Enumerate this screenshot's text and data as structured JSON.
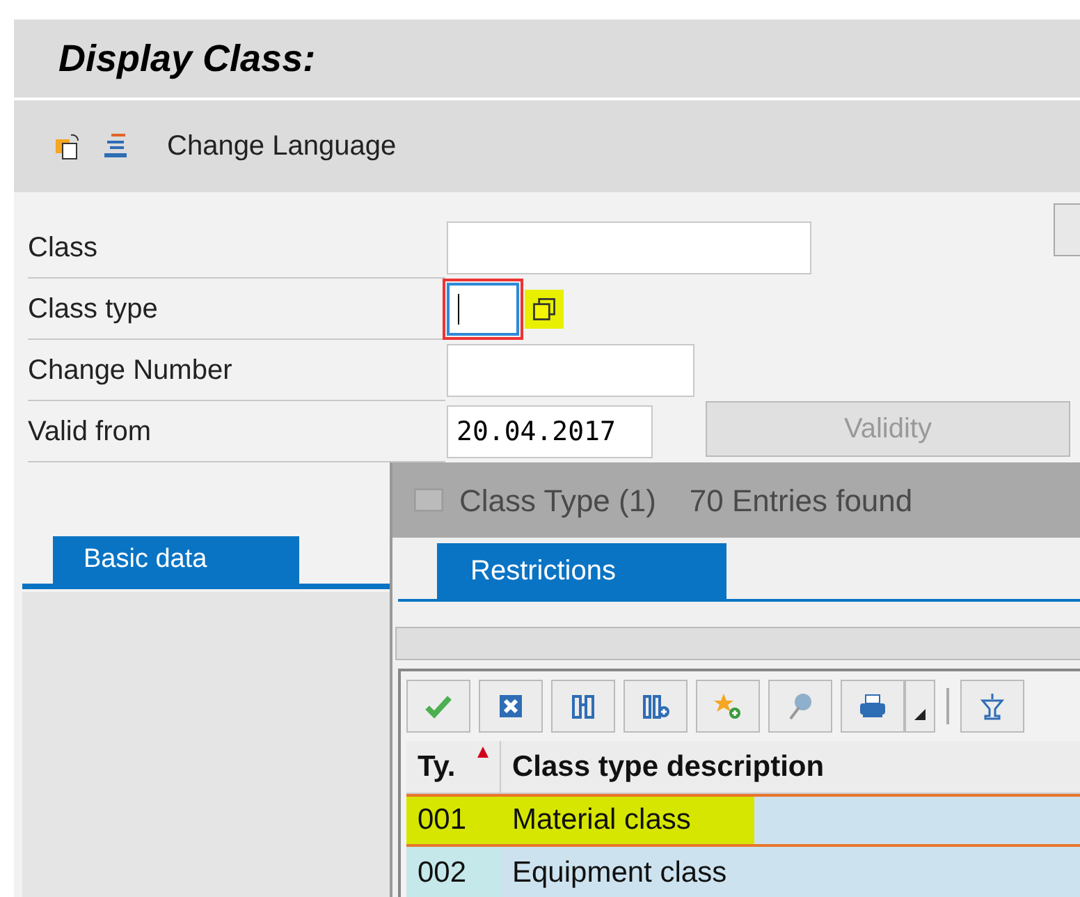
{
  "window": {
    "title": "Display Class:"
  },
  "toolbar": {
    "items": [
      {
        "kind": "icon"
      },
      {
        "kind": "icon"
      },
      {
        "kind": "text",
        "label": "Change Language"
      }
    ]
  },
  "form": {
    "fields": [
      {
        "kind": "text",
        "label": "Class",
        "focused": false
      },
      {
        "kind": "lookup",
        "label": "Class type",
        "focused": true
      },
      {
        "kind": "text",
        "label": "Change Number",
        "focused": false
      },
      {
        "kind": "text",
        "label": "Valid from",
        "value": "20.04.2017",
        "focused": false
      }
    ],
    "validity_button": {
      "label": "Validity",
      "disabled": true
    }
  },
  "tabs": [
    {
      "label": "Basic data",
      "selected": true
    }
  ],
  "popup": {
    "title": "Class Type (1)",
    "count": "70 Entries found",
    "tabs": [
      {
        "label": "Restrictions",
        "selected": true
      }
    ],
    "table": {
      "columns": [
        "Ty.",
        "Class type description"
      ],
      "rows": [
        {
          "cells": [
            "001",
            "Material class"
          ],
          "selected": true
        },
        {
          "cells": [
            "002",
            "Equipment class"
          ],
          "selected": false
        }
      ]
    }
  }
}
